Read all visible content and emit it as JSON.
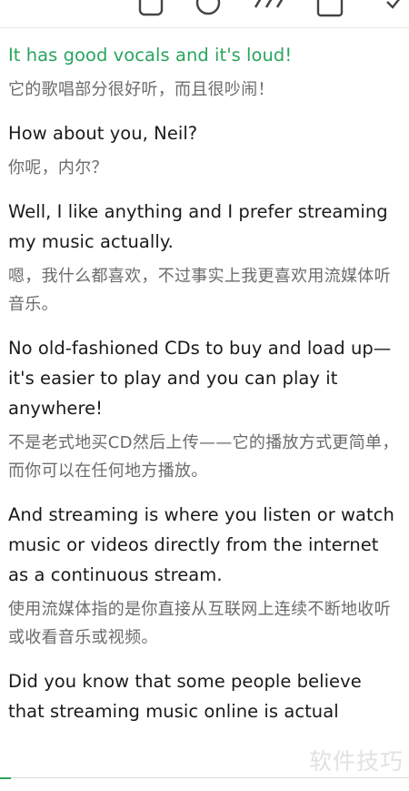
{
  "toolbar": {
    "icons": [
      "copy-icon",
      "timer-icon",
      "speed-icon",
      "square-icon",
      "more-icon"
    ]
  },
  "lines": [
    {
      "en": "It has good vocals and it's loud!",
      "zh": "它的歌唱部分很好听，而且很吵闹！"
    },
    {
      "en": "How about you, Neil?",
      "zh": "你呢，内尔？"
    },
    {
      "en": "Well, I like anything and I prefer streaming my music actually.",
      "zh": "嗯，我什么都喜欢，不过事实上我更喜欢用流媒体听音乐。"
    },
    {
      "en": "No old-fashioned CDs to buy and load up—it's easier to play and you can play it anywhere!",
      "zh": "不是老式地买CD然后上传——它的播放方式更简单，而你可以在任何地方播放。"
    },
    {
      "en": "And streaming is where you listen or watch music or videos directly from the internet as a continuous stream.",
      "zh": "使用流媒体指的是你直接从互联网上连续不断地收听或收看音乐或视频。"
    },
    {
      "en": "Did you know that some people believe that streaming music online is actual"
    }
  ],
  "watermark": "软件技巧",
  "colors": {
    "highlight": "#2aa55e",
    "english": "#1a1a1a",
    "chinese": "#6b6b6b"
  }
}
